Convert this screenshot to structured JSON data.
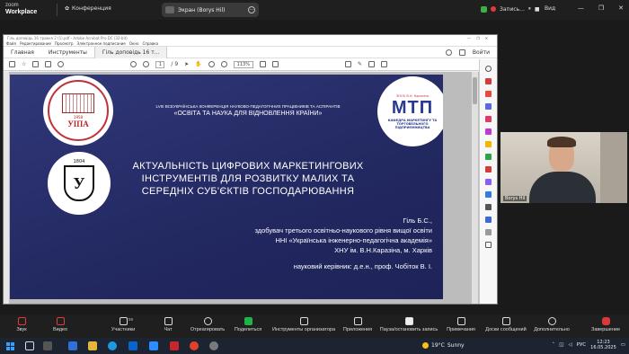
{
  "zoom": {
    "brand_line1": "zoom",
    "brand_line2": "Workplace",
    "conference_label": "Конференция",
    "screen_share_label": "Экран (Borys Hil)",
    "recording_label": "Запись...",
    "view_label": "Вид",
    "window_controls": [
      "—",
      "❐",
      "✕"
    ]
  },
  "acrobat": {
    "title": "Гіль доповідь 16 травня 2 (1).pdf - Adobe Acrobat Pro DC (32-bit)",
    "menu": [
      "Файл",
      "Редактирование",
      "Просмотр",
      "Электронное подписание",
      "Окно",
      "Справка"
    ],
    "tabs": [
      "Главная",
      "Инструменты",
      "Гіль доповідь 16 т..."
    ],
    "signin_label": "Войти",
    "page_current": "1",
    "page_total": "/ 9",
    "zoom_value": "113%"
  },
  "slide": {
    "uipa_year": "1958",
    "uipa_abbr": "УІПА",
    "khnu_year": "1804",
    "khnu_letter": "У",
    "mtp_top": "ЗНІ ЕІ В.Н. Каразіна",
    "mtp_abbr": "МТП",
    "mtp_caption": "КАФЕДРА МАРКЕТИНГУ ТА ТОРГОВЕЛЬНОГО ПІДПРИЄМНИЦТВА",
    "conference_line1": "LVIII ВСЕУКРАЇНСЬКА КОНФЕРЕНЦІЯ НАУКОВО-ПЕДАГОГІЧНИХ ПРАЦІВНИКІВ ТА АСПІРАНТІВ",
    "conference_line2": "«ОСВІТА ТА НАУКА ДЛЯ ВІДНОВЛЕННЯ КРАЇНИ»",
    "title_lines": [
      "АКТУАЛЬНІСТЬ ЦИФРОВИХ МАРКЕТИНГОВИХ",
      "ІНСТРУМЕНТІВ ДЛЯ РОЗВИТКУ МАЛИХ ТА",
      "СЕРЕДНІХ СУБ'ЄКТІВ ГОСПОДАРЮВАННЯ"
    ],
    "author_lines": [
      "Гіль Б.С.,",
      "здобувач третього освітньо-наукового рівня вищої освіти",
      "ННІ «Українська інженерно-педагогічна академія»",
      "ХНУ ім. В.Н.Каразіна, м. Харків"
    ],
    "supervisor": "науковий керівник: д.е.н., проф. Чобіток В. І."
  },
  "webcam": {
    "name": "Borys Hil"
  },
  "toolbar": {
    "mute": "Звук",
    "video": "Видео",
    "participants": "Участники",
    "participants_count": "59",
    "chat": "Чат",
    "react": "Отреагировать",
    "share": "Поделиться",
    "host_tools": "Инструменты организатора",
    "apps": "Приложения",
    "pause_record": "Пауза/остановить запись",
    "notes": "Примечания",
    "whiteboards": "Доски сообщений",
    "more": "Дополнительно",
    "end": "Завершение"
  },
  "taskbar": {
    "weather_temp": "19°C",
    "weather_text": "Sunny",
    "language": "РУС",
    "time": "12:23",
    "date": "16.05.2025"
  },
  "colors": {
    "slide_bg": "#272d6c",
    "zoom_bar": "#1f1f1f",
    "share_green": "#1fb34a",
    "end_red": "#d83a3a"
  }
}
